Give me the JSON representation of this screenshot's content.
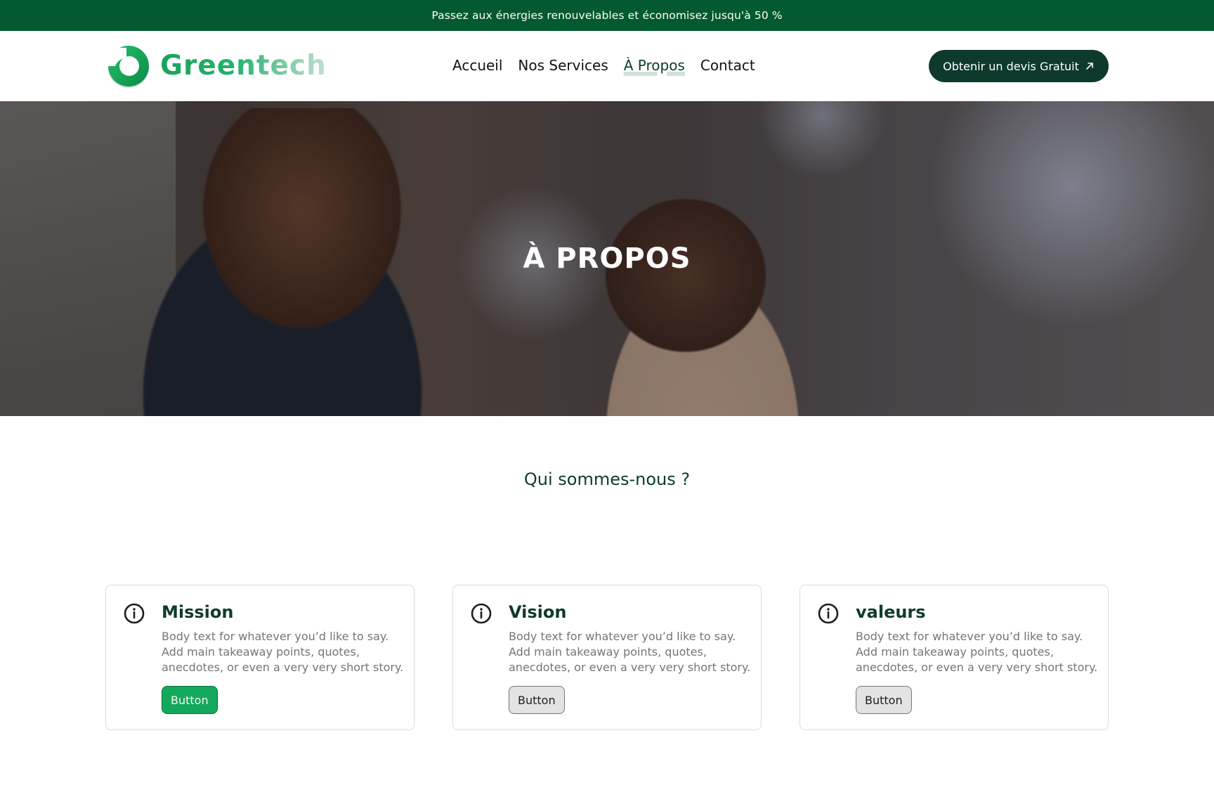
{
  "topbar": {
    "text": "Passez aux énergies renouvelables et économisez jusqu'à 50 %"
  },
  "brand": {
    "name": "Greentech",
    "logo_icon": "leaf-drop-icon",
    "color": "#1aa35a"
  },
  "nav": {
    "items": [
      {
        "label": "Accueil",
        "active": false
      },
      {
        "label": "Nos Services",
        "active": false
      },
      {
        "label": "À Propos",
        "active": true
      },
      {
        "label": "Contact",
        "active": false
      }
    ],
    "cta_label": "Obtenir un devis Gratuit",
    "cta_icon": "arrow-up-right-icon"
  },
  "hero": {
    "title": "À PROPOS"
  },
  "about": {
    "title": "Qui sommes-nous ?"
  },
  "cards": [
    {
      "title": "Mission",
      "body": "Body text for whatever you’d like to say. Add main takeaway points, quotes, anecdotes, or even a very very short story.",
      "button": "Button",
      "icon": "info-icon",
      "variant": "primary"
    },
    {
      "title": "Vision",
      "body": "Body text for whatever you’d like to say. Add main takeaway points, quotes, anecdotes, or even a very very short story.",
      "button": "Button",
      "icon": "info-icon",
      "variant": "neutral"
    },
    {
      "title": "valeurs",
      "body": "Body text for whatever you’d like to say. Add main takeaway points, quotes, anecdotes, or even a very very short story.",
      "button": "Button",
      "icon": "info-icon",
      "variant": "neutral"
    }
  ],
  "colors": {
    "topbar": "#035a2e",
    "cta": "#0d3a2d",
    "primary_button": "#14a85a",
    "heading": "#0e3b2c"
  }
}
